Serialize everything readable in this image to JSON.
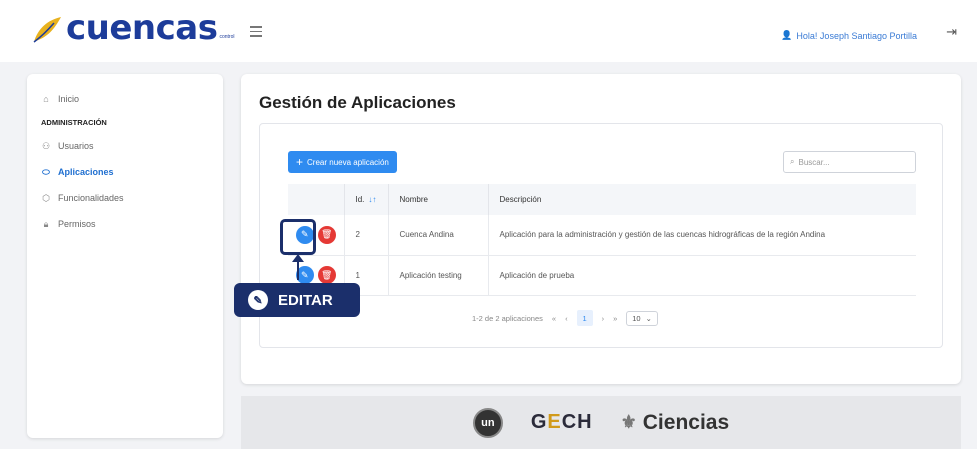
{
  "header": {
    "logo_text": "cuencas",
    "logo_sub": "control",
    "greeting": "Hola! Joseph Santiago Portilla",
    "logout_icon": "logout-icon"
  },
  "sidebar": {
    "items": [
      {
        "label": "Inicio",
        "icon": "home-icon"
      },
      {
        "label": "Usuarios",
        "icon": "users-icon"
      },
      {
        "label": "Aplicaciones",
        "icon": "apps-icon"
      },
      {
        "label": "Funcionalidades",
        "icon": "cube-icon"
      },
      {
        "label": "Permisos",
        "icon": "lock-icon"
      }
    ],
    "heading": "ADMINISTRACIÓN",
    "active": "Aplicaciones"
  },
  "main": {
    "title": "Gestión de Aplicaciones",
    "new_button": "Crear nueva aplicación",
    "search_placeholder": "Buscar...",
    "table": {
      "headers": [
        "",
        "Id.",
        "Nombre",
        "Descripción"
      ],
      "rows": [
        {
          "id": "2",
          "name": "Cuenca Andina",
          "description": "Aplicación para la administración y gestión de las cuencas hidrográficas de la región Andina"
        },
        {
          "id": "1",
          "name": "Aplicación testing",
          "description": "Aplicación de prueba"
        }
      ]
    },
    "pagination": {
      "summary": "1-2 de 2 aplicaciones",
      "first": "«",
      "prev": "‹",
      "current": "1",
      "next": "›",
      "last": "»",
      "page_size": "10"
    }
  },
  "annotation": {
    "label": "EDITAR"
  },
  "footer": {
    "un_logo": "un",
    "gech": "GECH",
    "ciencias": "Ciencias"
  },
  "colors": {
    "brand": "#1d3c9a",
    "primary": "#2f8bf0",
    "danger": "#e53935",
    "annotation": "#1b2f6b"
  }
}
